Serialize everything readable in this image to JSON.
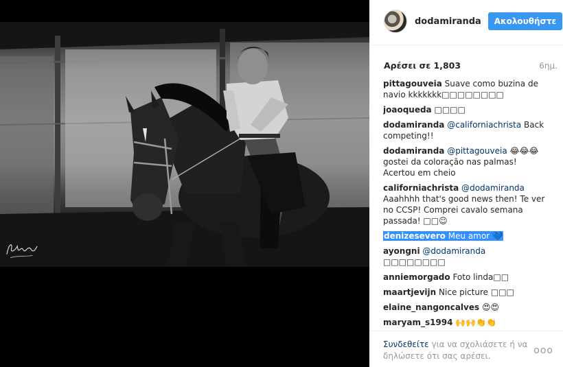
{
  "post": {
    "author": "dodamiranda",
    "follow_label": "Ακολουθήστε",
    "likes_label": "Αρέσει σε 1,803",
    "time_ago": "6ημ.",
    "watermark_signature": "Rafael Miranda"
  },
  "comments": [
    {
      "user": "pittagouveia",
      "text": "Suave como buzina de navio kkkkkkk□□□□□□□□",
      "mention": ""
    },
    {
      "user": "joaoqueda",
      "text": "□□□□",
      "mention": ""
    },
    {
      "user": "dodamiranda",
      "mention": "@californiachrista",
      "text": " Back competing!!"
    },
    {
      "user": "dodamiranda",
      "mention": "@pittagouveia",
      "text": " 😂😂😂 gostei da coloração nas palmas! Acertou em cheio"
    },
    {
      "user": "californiachrista",
      "mention": "@dodamiranda",
      "text": " Aaahhhh that's good news then! Te ver no CCSP! Comprei cavalo semana passada! □□☺"
    },
    {
      "user": "denizesevero",
      "text": "Meu amor 💙",
      "mention": "",
      "highlighted": true
    },
    {
      "user": "ayongni",
      "mention": "@dodamiranda",
      "text": " □□□□□□□□"
    },
    {
      "user": "anniemorgado",
      "text": "Foto linda□□",
      "mention": ""
    },
    {
      "user": "maartjevijn",
      "text": "Nice picture □□□",
      "mention": ""
    },
    {
      "user": "elaine_nangoncalves",
      "text": "😍😍",
      "mention": ""
    },
    {
      "user": "maryam_s1994",
      "text": "🙌🙌👏👏",
      "mention": ""
    }
  ],
  "footer": {
    "login_link": "Συνδεθείτε",
    "login_rest": " για να σχολιάσετε ή να δηλώσετε ότι σας αρέσει.",
    "more": "ooo"
  }
}
